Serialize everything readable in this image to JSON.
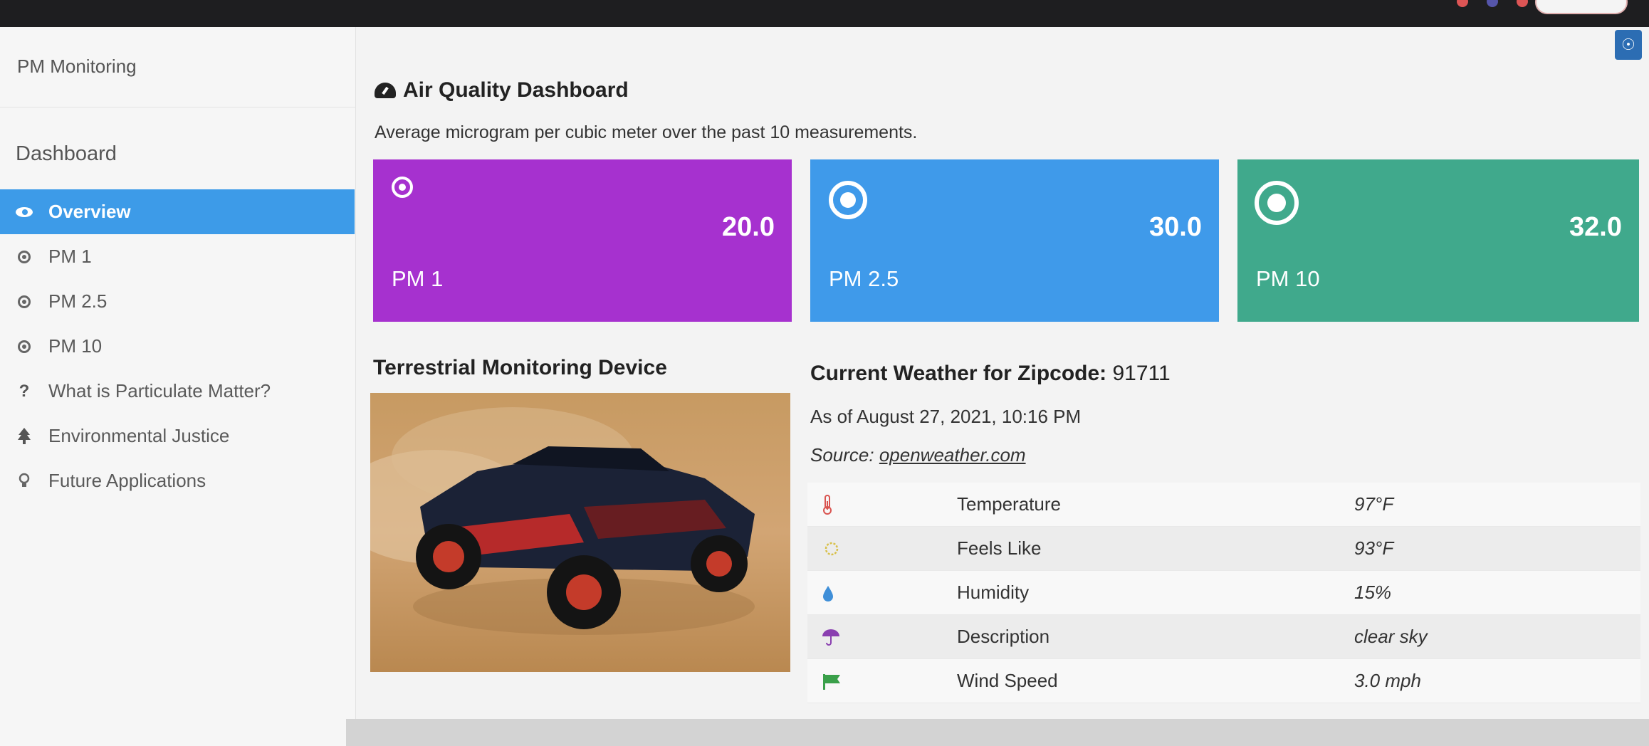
{
  "sidebar": {
    "brand": "PM Monitoring",
    "section": "Dashboard",
    "items": [
      {
        "label": "Overview",
        "icon": "eye-icon",
        "active": true
      },
      {
        "label": "PM 1",
        "icon": "dot-circle-icon"
      },
      {
        "label": "PM 2.5",
        "icon": "dot-circle-icon"
      },
      {
        "label": "PM 10",
        "icon": "dot-circle-icon"
      },
      {
        "label": "What is Particulate Matter?",
        "icon": "question-icon"
      },
      {
        "label": "Environmental Justice",
        "icon": "tree-icon"
      },
      {
        "label": "Future Applications",
        "icon": "lightbulb-icon"
      }
    ]
  },
  "main": {
    "title": "Air Quality Dashboard",
    "subtitle": "Average microgram per cubic meter over the past 10 measurements.",
    "cards": [
      {
        "label": "PM 1",
        "value": "20.0",
        "color": "#a631cf"
      },
      {
        "label": "PM 2.5",
        "value": "30.0",
        "color": "#3f9aea"
      },
      {
        "label": "PM 10",
        "value": "32.0",
        "color": "#40a98c"
      }
    ],
    "device_title": "Terrestrial Monitoring Device",
    "weather": {
      "title_bold": "Current Weather for Zipcode:",
      "zipcode": "91711",
      "as_of": "As of August 27, 2021, 10:16 PM",
      "source_label": "Source:",
      "source_link": "openweather.com",
      "rows": [
        {
          "icon": "thermometer-icon",
          "label": "Temperature",
          "value": "97°F"
        },
        {
          "icon": "sun-icon",
          "label": "Feels Like",
          "value": "93°F"
        },
        {
          "icon": "droplet-icon",
          "label": "Humidity",
          "value": "15%"
        },
        {
          "icon": "umbrella-icon",
          "label": "Description",
          "value": "clear sky"
        },
        {
          "icon": "flag-icon",
          "label": "Wind Speed",
          "value": "3.0 mph"
        }
      ]
    }
  },
  "colors": {
    "accent": "#3d9be8",
    "sidebar_bg": "#f6f6f6"
  }
}
